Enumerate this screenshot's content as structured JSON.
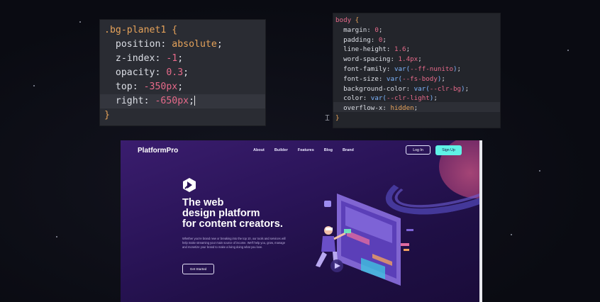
{
  "code_left": {
    "lines": [
      [
        {
          "t": ".bg-planet1 ",
          "c": "sel"
        },
        {
          "t": "{",
          "c": "brace"
        }
      ],
      [
        {
          "t": "  position: ",
          "c": "prop"
        },
        {
          "t": "absolute",
          "c": "val"
        },
        {
          "t": ";",
          "c": "prop"
        }
      ],
      [
        {
          "t": "  z-index: ",
          "c": "prop"
        },
        {
          "t": "-1",
          "c": "num"
        },
        {
          "t": ";",
          "c": "prop"
        }
      ],
      [
        {
          "t": "  opacity: ",
          "c": "prop"
        },
        {
          "t": "0.3",
          "c": "num"
        },
        {
          "t": ";",
          "c": "prop"
        }
      ],
      [
        {
          "t": "  top: ",
          "c": "prop"
        },
        {
          "t": "-350",
          "c": "num"
        },
        {
          "t": "px",
          "c": "unit"
        },
        {
          "t": ";",
          "c": "prop"
        }
      ],
      [
        {
          "t": "  right: ",
          "c": "prop"
        },
        {
          "t": "-650",
          "c": "num"
        },
        {
          "t": "px",
          "c": "unit"
        },
        {
          "t": ";",
          "c": "prop"
        },
        {
          "t": "|caret|",
          "c": "caret"
        }
      ],
      [
        {
          "t": "}",
          "c": "brace"
        }
      ]
    ]
  },
  "code_right": {
    "lines": [
      [
        {
          "t": "body ",
          "c": "num"
        },
        {
          "t": "{",
          "c": "brace"
        }
      ],
      [
        {
          "t": "  margin: ",
          "c": "prop"
        },
        {
          "t": "0",
          "c": "num"
        },
        {
          "t": ";",
          "c": "prop"
        }
      ],
      [
        {
          "t": "  padding: ",
          "c": "prop"
        },
        {
          "t": "0",
          "c": "num"
        },
        {
          "t": ";",
          "c": "prop"
        }
      ],
      [
        {
          "t": "  line-height: ",
          "c": "prop"
        },
        {
          "t": "1.6",
          "c": "num"
        },
        {
          "t": ";",
          "c": "prop"
        }
      ],
      [
        {
          "t": "  word-spacing: ",
          "c": "prop"
        },
        {
          "t": "1.4px",
          "c": "num"
        },
        {
          "t": ";",
          "c": "prop"
        }
      ],
      [
        {
          "t": "  font-family: ",
          "c": "prop"
        },
        {
          "t": "var(",
          "c": "var"
        },
        {
          "t": "--ff-nunito",
          "c": "arg"
        },
        {
          "t": ")",
          "c": "var"
        },
        {
          "t": ";",
          "c": "prop"
        }
      ],
      [
        {
          "t": "  font-size: ",
          "c": "prop"
        },
        {
          "t": "var(",
          "c": "var"
        },
        {
          "t": "--fs-body",
          "c": "arg"
        },
        {
          "t": ")",
          "c": "var"
        },
        {
          "t": ";",
          "c": "prop"
        }
      ],
      [
        {
          "t": "  background-color: ",
          "c": "prop"
        },
        {
          "t": "var(",
          "c": "var"
        },
        {
          "t": "--clr-bg",
          "c": "arg"
        },
        {
          "t": ")",
          "c": "var"
        },
        {
          "t": ";",
          "c": "prop"
        }
      ],
      [
        {
          "t": "  color: ",
          "c": "prop"
        },
        {
          "t": "var(",
          "c": "var"
        },
        {
          "t": "--clr-light",
          "c": "arg"
        },
        {
          "t": ")",
          "c": "var"
        },
        {
          "t": ";",
          "c": "prop"
        }
      ],
      [
        {
          "t": "  overflow-x: ",
          "c": "prop"
        },
        {
          "t": "hidden",
          "c": "val"
        },
        {
          "t": ";",
          "c": "prop"
        }
      ],
      [
        {
          "t": "}",
          "c": "brace"
        }
      ]
    ]
  },
  "site": {
    "brand": "PlatformPro",
    "nav": [
      "About",
      "Builder",
      "Features",
      "Blog",
      "Brand"
    ],
    "login_label": "Log In",
    "signup_label": "Sign Up",
    "hero_title_lines": [
      "The web",
      "design platform",
      "for content creators."
    ],
    "hero_desc": "Whether you're brand new or breaking into the top 10, our tools and services will help make streaming your main source of income. We'll help you, grow, manage and monetize your brand to make a living doing what you love.",
    "cta_label": "Get Started"
  },
  "colors": {
    "accent_cyan": "#5ff2e6",
    "site_bg": "#2a1458",
    "planet": "#b24a7a",
    "ring": "#4b3fa8"
  }
}
